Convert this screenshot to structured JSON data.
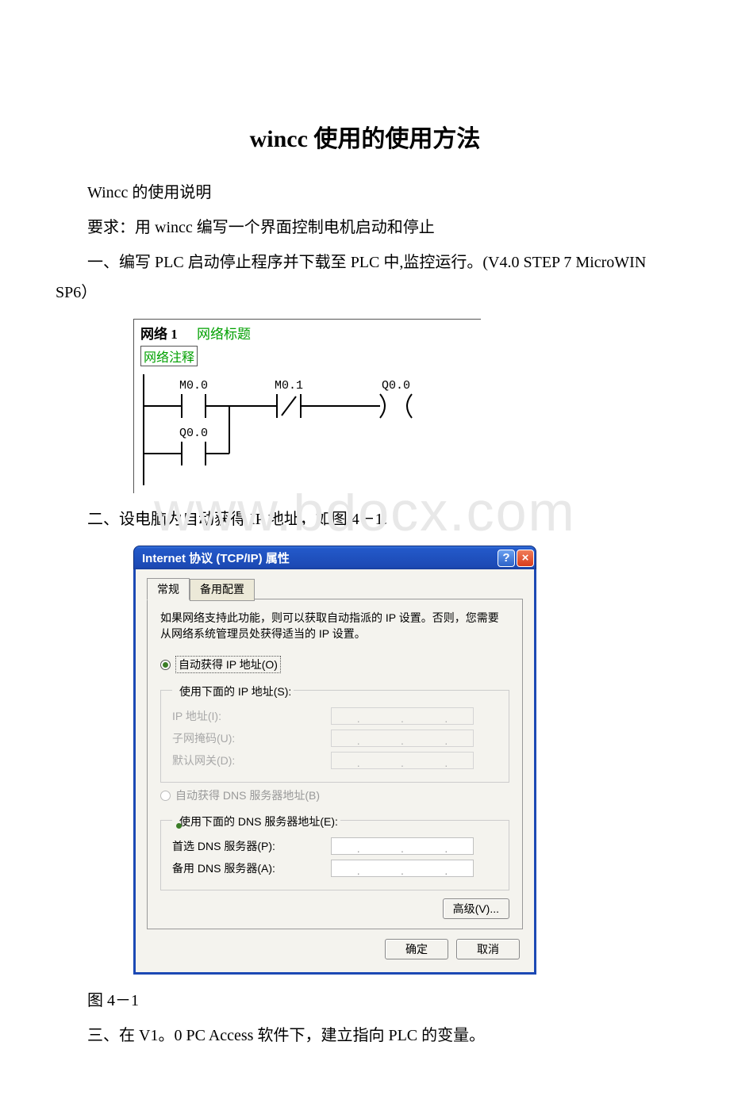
{
  "doc": {
    "title_prefix": "wincc",
    "title_cn": " 使用的使用方法",
    "p1_cn": "Wincc 的使用说明",
    "p2_cn_a": "要求：用 ",
    "p2_latin": "wincc",
    "p2_cn_b": " 编写一个界面控制电机启动和停止",
    "p3_cn_a": "一、编写 ",
    "p3_latin_a": "PLC",
    "p3_cn_b": " 启动停止程序并下载至 ",
    "p3_latin_b": "PLC",
    "p3_cn_c": " 中,监控运行。",
    "p3_latin_c": "(V4.0 STEP 7 MicroWIN SP6",
    "p3_cn_d": "）",
    "p4_cn_a": "二、设电脑为自动获得 ",
    "p4_latin": "IP",
    "p4_cn_b": " 地址，如图 4－1:",
    "caption1": "图 4－1",
    "p5_cn_a": "三、在 ",
    "p5_latin_a": "V1",
    "p5_cn_b": "。",
    "p5_latin_b": "0 PC Access",
    "p5_cn_c": " 软件下，建立指向 ",
    "p5_latin_c": "PLC",
    "p5_cn_d": " 的变量。"
  },
  "ladder": {
    "net_num": "网络 1",
    "net_title": "网络标题",
    "net_comment": "网络注释",
    "m00": "M0.0",
    "m01": "M0.1",
    "q00_top": "Q0.0",
    "q00_bot": "Q0.0"
  },
  "dialog": {
    "title": "Internet 协议 (TCP/IP) 属性",
    "tab_general": "常规",
    "tab_alt": "备用配置",
    "intro": "如果网络支持此功能，则可以获取自动指派的 IP 设置。否则，您需要从网络系统管理员处获得适当的 IP 设置。",
    "radio_auto_ip": "自动获得 IP 地址(O)",
    "radio_manual_ip": "使用下面的 IP 地址(S):",
    "label_ip": "IP 地址(I):",
    "label_mask": "子网掩码(U):",
    "label_gw": "默认网关(D):",
    "radio_auto_dns": "自动获得 DNS 服务器地址(B)",
    "radio_manual_dns": "使用下面的 DNS 服务器地址(E):",
    "label_pref_dns": "首选 DNS 服务器(P):",
    "label_alt_dns": "备用 DNS 服务器(A):",
    "btn_advanced": "高级(V)...",
    "btn_ok": "确定",
    "btn_cancel": "取消"
  },
  "watermark": "www.bdocx.com"
}
